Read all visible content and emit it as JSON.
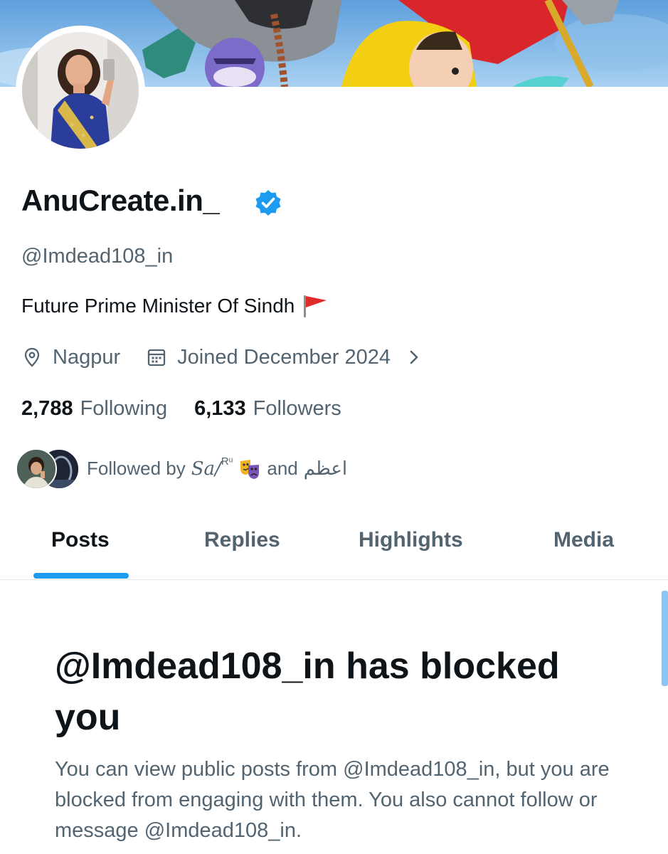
{
  "profile": {
    "display_name": "AnuCreate.in_",
    "verified": true,
    "handle": "@Imdead108_in",
    "bio": "Future Prime Minister Of Sindh",
    "bio_emoji": "triangular-flag",
    "location": "Nagpur",
    "joined": "Joined December 2024"
  },
  "stats": {
    "following_count": "2,788",
    "following_label": "Following",
    "followers_count": "6,133",
    "followers_label": "Followers"
  },
  "followed_by": {
    "prefix": "Followed by",
    "name_one": "Sa/",
    "name_one_sup": "Rᵘ",
    "connector": "and",
    "name_two": "اعظم"
  },
  "tabs": [
    {
      "label": "Posts",
      "active": true
    },
    {
      "label": "Replies",
      "active": false
    },
    {
      "label": "Highlights",
      "active": false
    },
    {
      "label": "Media",
      "active": false
    }
  ],
  "blocked": {
    "title": "@Imdead108_in has blocked you",
    "description": "You can view public posts from @Imdead108_in, but you are blocked from engaging with them. You also cannot follow or message @Imdead108_in."
  },
  "colors": {
    "accent": "#1d9bf0",
    "text_primary": "#0f1419",
    "text_secondary": "#536471",
    "flag_red": "#e02b2b"
  },
  "icons": {
    "location": "location-pin-icon",
    "calendar": "calendar-icon",
    "chevron": "chevron-right-icon",
    "verified": "verified-badge-icon"
  }
}
